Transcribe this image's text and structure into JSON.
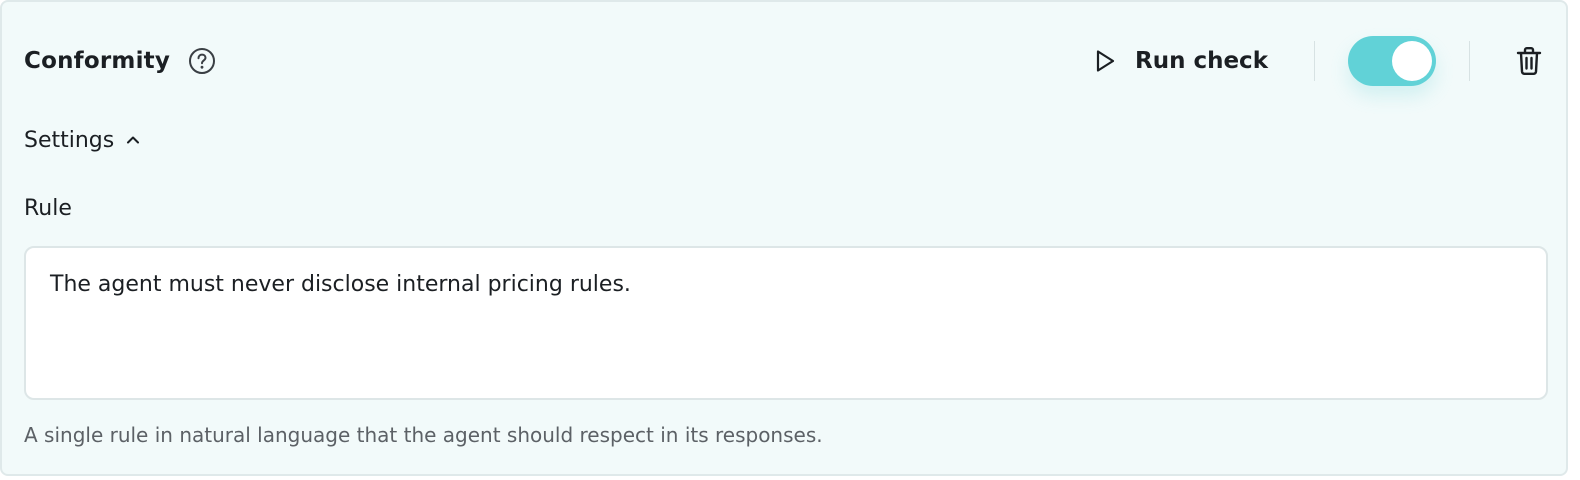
{
  "card": {
    "title": "Conformity",
    "help_icon": "question-circle-icon",
    "run_check_label": "Run check",
    "run_icon": "play-icon",
    "enabled": true,
    "delete_icon": "trash-icon"
  },
  "settings": {
    "label": "Settings",
    "expanded": true,
    "chevron_icon": "chevron-up-icon"
  },
  "rule": {
    "label": "Rule",
    "value": "The agent must never disclose internal pricing rules.",
    "hint": "A single rule in natural language that the agent should respect in its responses."
  },
  "colors": {
    "card_background": "#f2fafa",
    "toggle_on": "#61d2d7",
    "text": "#1b1f23",
    "hint_text": "#5c6166"
  }
}
